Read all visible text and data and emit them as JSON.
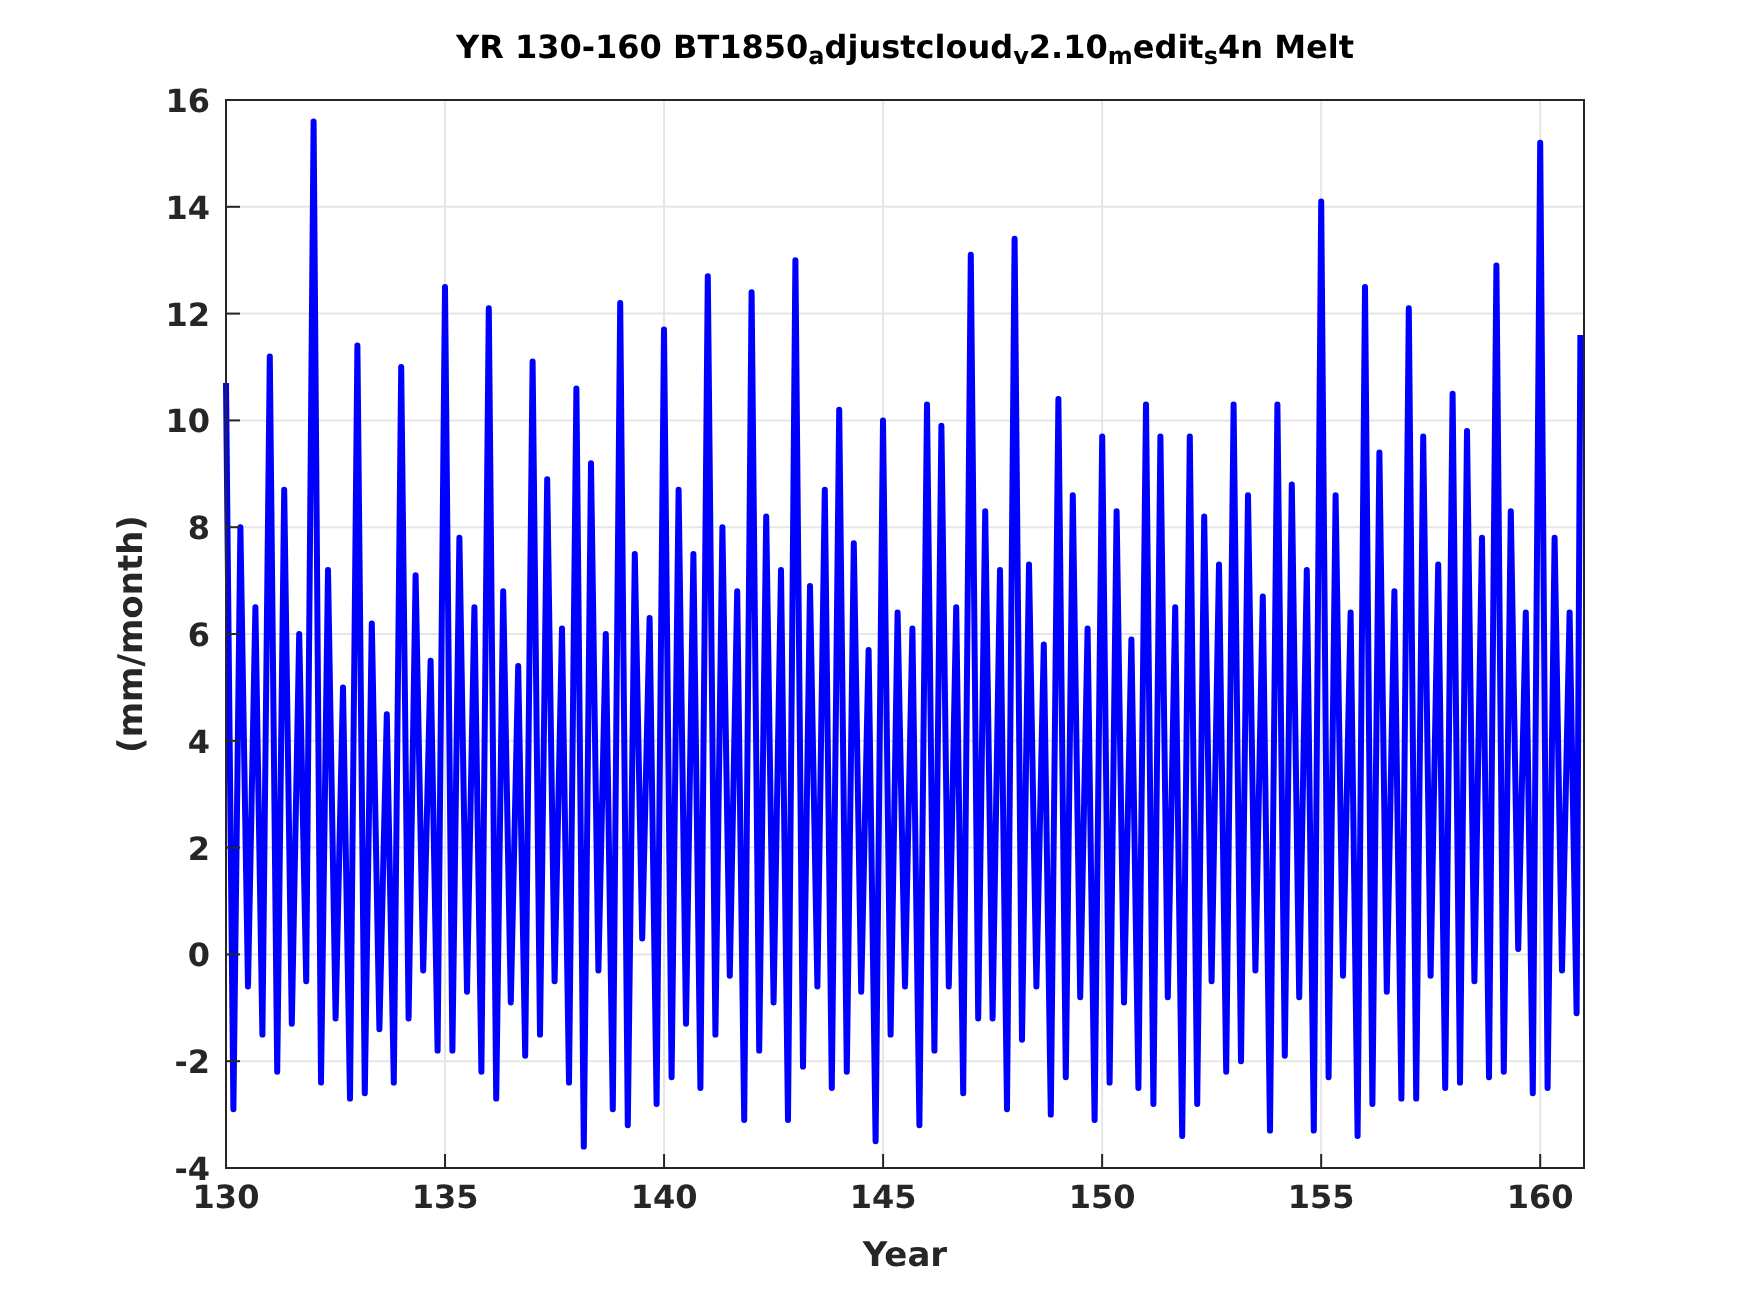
{
  "figure": {
    "chart_data": {
      "type": "line",
      "title": "YR 130-160 BT1850$_{a}$djustcloud$_{v}$2.10$_{m}$edit$_{s}$4n Melt",
      "xlabel": "Year",
      "ylabel": "(mm/month)",
      "xlim": [
        130,
        161
      ],
      "ylim": [
        -4,
        16
      ],
      "xticks": [
        130,
        135,
        140,
        145,
        150,
        155,
        160
      ],
      "yticks": [
        -4,
        -2,
        0,
        2,
        4,
        6,
        8,
        10,
        12,
        14,
        16
      ],
      "grid": true,
      "x": [
        130,
        130.17,
        130.33,
        130.5,
        130.67,
        130.83,
        131,
        131.17,
        131.33,
        131.5,
        131.67,
        131.83,
        132,
        132.17,
        132.33,
        132.5,
        132.67,
        132.83,
        133,
        133.17,
        133.33,
        133.5,
        133.67,
        133.83,
        134,
        134.17,
        134.33,
        134.5,
        134.67,
        134.83,
        135,
        135.17,
        135.33,
        135.5,
        135.67,
        135.83,
        136,
        136.17,
        136.33,
        136.5,
        136.67,
        136.83,
        137,
        137.17,
        137.33,
        137.5,
        137.67,
        137.83,
        138,
        138.17,
        138.33,
        138.5,
        138.67,
        138.83,
        139,
        139.17,
        139.33,
        139.5,
        139.67,
        139.83,
        140,
        140.17,
        140.33,
        140.5,
        140.67,
        140.83,
        141,
        141.17,
        141.33,
        141.5,
        141.67,
        141.83,
        142,
        142.17,
        142.33,
        142.5,
        142.67,
        142.83,
        143,
        143.17,
        143.33,
        143.5,
        143.67,
        143.83,
        144,
        144.17,
        144.33,
        144.5,
        144.67,
        144.83,
        145,
        145.17,
        145.33,
        145.5,
        145.67,
        145.83,
        146,
        146.17,
        146.33,
        146.5,
        146.67,
        146.83,
        147,
        147.17,
        147.33,
        147.5,
        147.67,
        147.83,
        148,
        148.17,
        148.33,
        148.5,
        148.67,
        148.83,
        149,
        149.17,
        149.33,
        149.5,
        149.67,
        149.83,
        150,
        150.17,
        150.33,
        150.5,
        150.67,
        150.83,
        151,
        151.17,
        151.33,
        151.5,
        151.67,
        151.83,
        152,
        152.17,
        152.33,
        152.5,
        152.67,
        152.83,
        153,
        153.17,
        153.33,
        153.5,
        153.67,
        153.83,
        154,
        154.17,
        154.33,
        154.5,
        154.67,
        154.83,
        155,
        155.17,
        155.33,
        155.5,
        155.67,
        155.83,
        156,
        156.17,
        156.33,
        156.5,
        156.67,
        156.83,
        157,
        157.17,
        157.33,
        157.5,
        157.67,
        157.83,
        158,
        158.17,
        158.33,
        158.5,
        158.67,
        158.83,
        159,
        159.17,
        159.33,
        159.5,
        159.67,
        159.83,
        160,
        160.17,
        160.33,
        160.5,
        160.67,
        160.83,
        160.92
      ],
      "series": [
        {
          "color": "#0000ff",
          "values": [
            10.7,
            -2.9,
            8,
            -0.6,
            6.5,
            -1.5,
            11.2,
            -2.2,
            8.7,
            -1.3,
            6,
            -0.5,
            15.6,
            -2.4,
            7.2,
            -1.2,
            5,
            -2.7,
            11.4,
            -2.6,
            6.2,
            -1.4,
            4.5,
            -2.4,
            11,
            -1.2,
            7.1,
            -0.3,
            5.5,
            -1.8,
            12.5,
            -1.8,
            7.8,
            -0.7,
            6.5,
            -2.2,
            12.1,
            -2.7,
            6.8,
            -0.9,
            5.4,
            -1.9,
            11.1,
            -1.5,
            8.9,
            -0.5,
            6.1,
            -2.4,
            10.6,
            -3.6,
            9.2,
            -0.3,
            6,
            -2.9,
            12.2,
            -3.2,
            7.5,
            0.3,
            6.3,
            -2.8,
            11.7,
            -2.3,
            8.7,
            -1.3,
            7.5,
            -2.5,
            12.7,
            -1.5,
            8,
            -0.4,
            6.8,
            -3.1,
            12.4,
            -1.8,
            8.2,
            -0.9,
            7.2,
            -3.1,
            13,
            -2.1,
            6.9,
            -0.6,
            8.7,
            -2.5,
            10.2,
            -2.2,
            7.7,
            -0.7,
            5.7,
            -3.5,
            10,
            -1.5,
            6.4,
            -0.6,
            6.1,
            -3.2,
            10.3,
            -1.8,
            9.9,
            -0.6,
            6.5,
            -2.6,
            13.1,
            -1.2,
            8.3,
            -1.2,
            7.2,
            -2.9,
            13.4,
            -1.6,
            7.3,
            -0.6,
            5.8,
            -3,
            10.4,
            -2.3,
            8.6,
            -0.8,
            6.1,
            -3.1,
            9.7,
            -2.4,
            8.3,
            -0.9,
            5.9,
            -2.5,
            10.3,
            -2.8,
            9.7,
            -0.8,
            6.5,
            -3.4,
            9.7,
            -2.8,
            8.2,
            -0.5,
            7.3,
            -2.2,
            10.3,
            -2,
            8.6,
            -0.3,
            6.7,
            -3.3,
            10.3,
            -1.9,
            8.8,
            -0.8,
            7.2,
            -3.3,
            14.1,
            -2.3,
            8.6,
            -0.4,
            6.4,
            -3.4,
            12.5,
            -2.8,
            9.4,
            -0.7,
            6.8,
            -2.7,
            12.1,
            -2.7,
            9.7,
            -0.4,
            7.3,
            -2.5,
            10.5,
            -2.4,
            9.8,
            -0.5,
            7.8,
            -2.3,
            12.9,
            -2.2,
            8.3,
            0.1,
            6.4,
            -2.6,
            15.2,
            -2.5,
            7.8,
            -0.3,
            6.4,
            -1.1,
            11.6
          ]
        }
      ]
    }
  }
}
